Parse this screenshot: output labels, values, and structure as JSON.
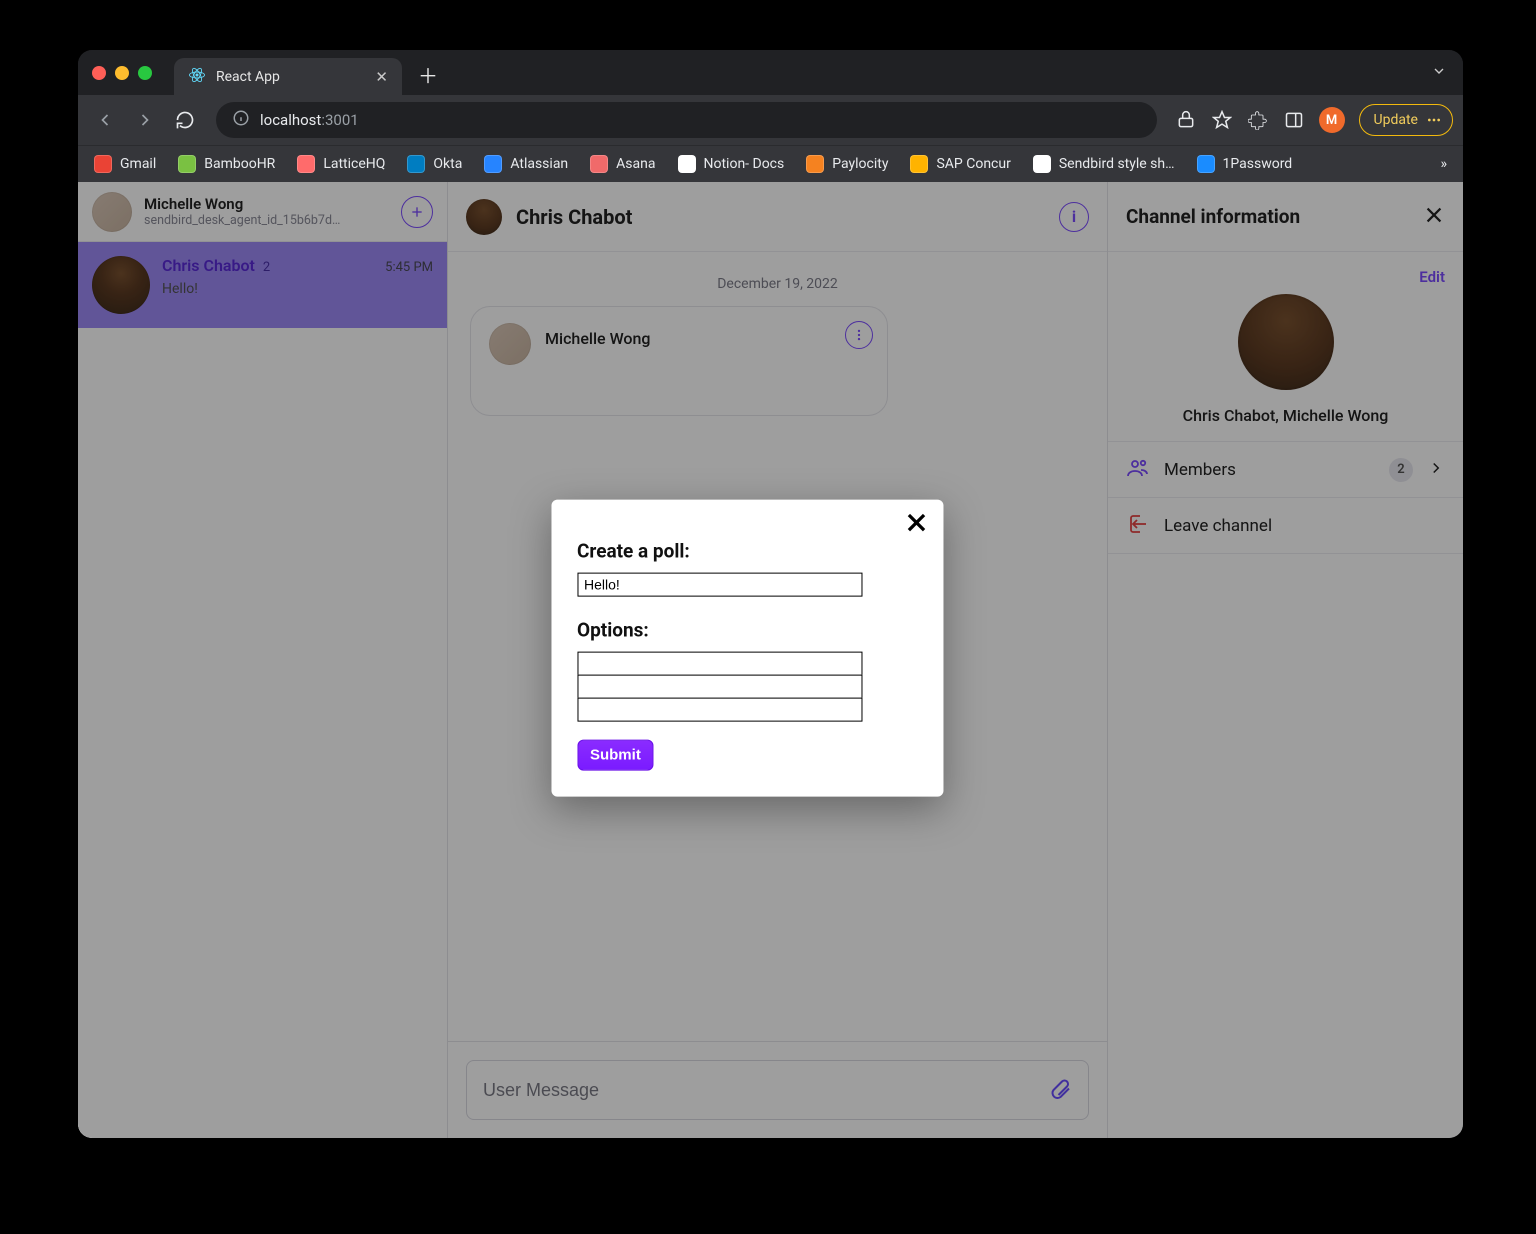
{
  "browser": {
    "tab_title": "React App",
    "url_host": "localhost",
    "url_port": ":3001",
    "update_label": "Update",
    "avatar_initial": "M"
  },
  "bookmarks": [
    {
      "label": "Gmail",
      "color": "#ea4335"
    },
    {
      "label": "BambooHR",
      "color": "#7ac142"
    },
    {
      "label": "LatticeHQ",
      "color": "#ff6b6b"
    },
    {
      "label": "Okta",
      "color": "#007dc1"
    },
    {
      "label": "Atlassian",
      "color": "#2684ff"
    },
    {
      "label": "Asana",
      "color": "#f06a6a"
    },
    {
      "label": "Notion- Docs",
      "color": "#ffffff"
    },
    {
      "label": "Paylocity",
      "color": "#f58220"
    },
    {
      "label": "SAP Concur",
      "color": "#ffb300"
    },
    {
      "label": "Sendbird style sh…",
      "color": "#ffffff"
    },
    {
      "label": "1Password",
      "color": "#1a8cff"
    }
  ],
  "sidebar": {
    "me_name": "Michelle Wong",
    "me_subtitle": "sendbird_desk_agent_id_15b6b7d…",
    "conversation": {
      "name": "Chris Chabot",
      "count": "2",
      "time": "5:45 PM",
      "preview": "Hello!"
    }
  },
  "chat": {
    "header_title": "Chris Chabot",
    "date_separator": "December 19, 2022",
    "message_sender": "Michelle Wong",
    "composer_placeholder": "User Message"
  },
  "info_panel": {
    "title": "Channel information",
    "edit_label": "Edit",
    "channel_names": "Chris Chabot, Michelle Wong",
    "members_label": "Members",
    "members_count": "2",
    "leave_label": "Leave channel"
  },
  "modal": {
    "title_label": "Create a poll:",
    "poll_title_value": "Hello!",
    "options_label": "Options:",
    "option_values": [
      "",
      "",
      ""
    ],
    "submit_label": "Submit"
  }
}
